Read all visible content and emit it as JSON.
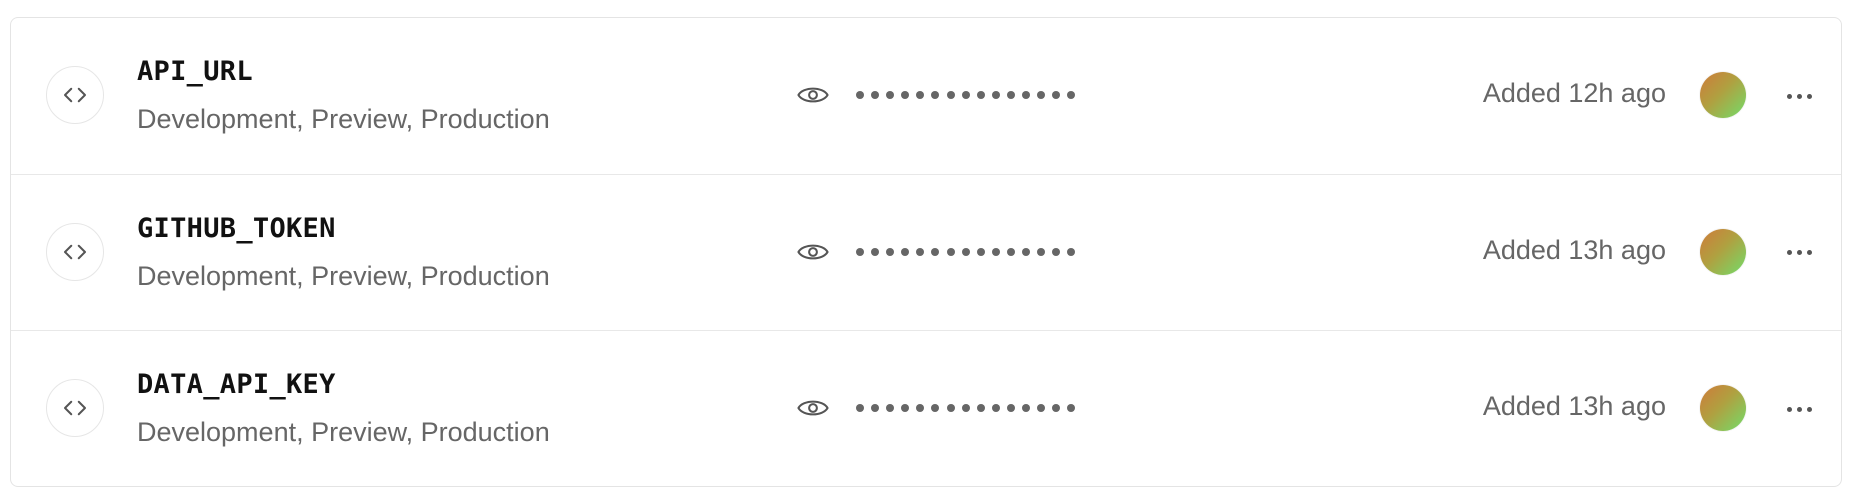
{
  "env_vars": [
    {
      "name": "API_URL",
      "environments": "Development, Preview, Production",
      "masked_value": "•••••••••••••••",
      "added": "Added 12h ago"
    },
    {
      "name": "GITHUB_TOKEN",
      "environments": "Development, Preview, Production",
      "masked_value": "•••••••••••••••",
      "added": "Added 13h ago"
    },
    {
      "name": "DATA_API_KEY",
      "environments": "Development, Preview, Production",
      "masked_value": "•••••••••••••••",
      "added": "Added 13h ago"
    }
  ],
  "icons": {
    "row_badge": "code-brackets-icon",
    "reveal": "eye-icon",
    "menu": "more-horizontal-icon"
  },
  "colors": {
    "border": "#e4e4e4",
    "primary_text": "#111111",
    "secondary_text": "#666666",
    "avatar_gradient_start": "#cf7a3a",
    "avatar_gradient_end": "#72dd6a"
  }
}
